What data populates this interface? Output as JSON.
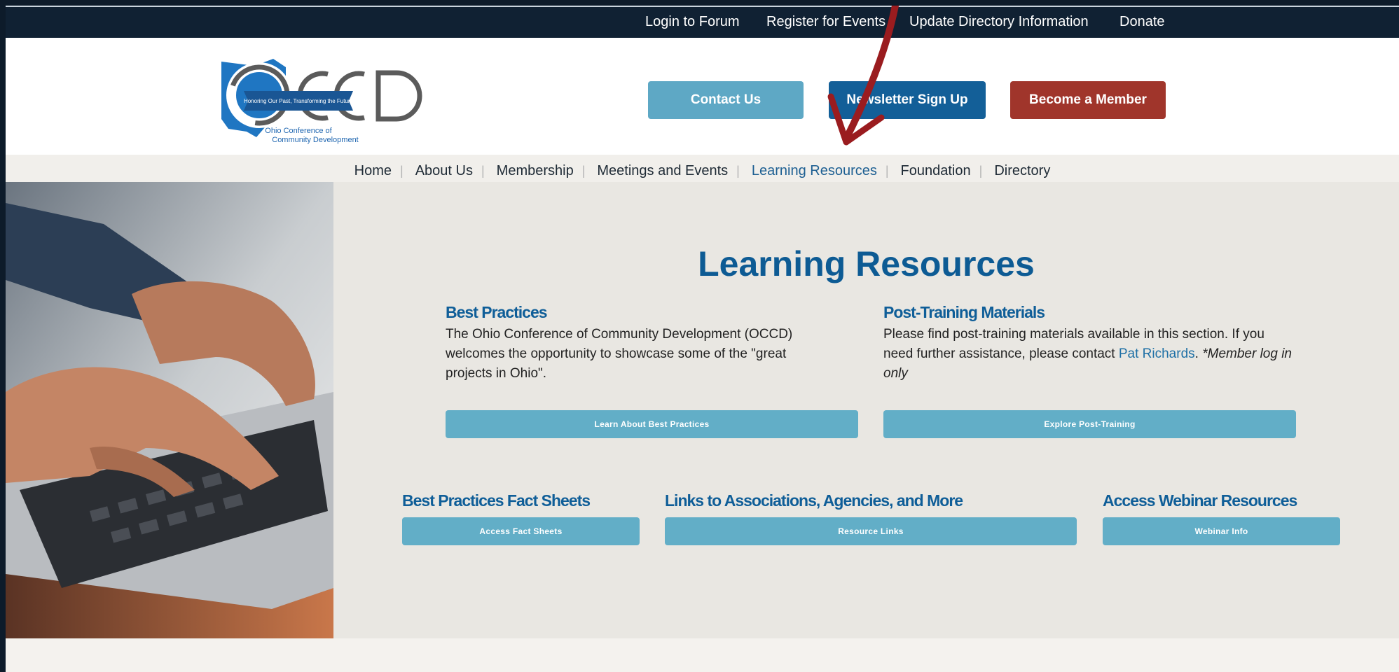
{
  "topbar": {
    "links": [
      "Login to Forum",
      "Register for Events",
      "Update Directory Information",
      "Donate"
    ]
  },
  "header": {
    "logo": {
      "text": "OCCD",
      "banner": "Honoring Our Past, Transforming the Future",
      "tagline_line1": "Ohio Conference of",
      "tagline_line2": "Community Development"
    },
    "buttons": {
      "contact": "Contact Us",
      "newsletter": "Newsletter Sign Up",
      "member": "Become a Member"
    }
  },
  "nav": {
    "items": [
      "Home",
      "About Us",
      "Membership",
      "Meetings and Events",
      "Learning Resources",
      "Foundation",
      "Directory"
    ],
    "active": "Learning Resources"
  },
  "main": {
    "title": "Learning Resources",
    "best_practices": {
      "heading": "Best Practices",
      "text": "The Ohio Conference of Community Development (OCCD) welcomes the opportunity to showcase some of the \"great projects in Ohio\".",
      "button": "Learn About Best Practices"
    },
    "post_training": {
      "heading": "Post-Training Materials",
      "text_before": "Please find post-training materials available in this section. If you need further assistance, please contact ",
      "link": "Pat Richards",
      "text_after": ". ",
      "note": "*Member log in only",
      "button": "Explore Post-Training"
    },
    "fact_sheets": {
      "heading": "Best Practices Fact Sheets",
      "button": "Access Fact Sheets"
    },
    "links": {
      "heading": "Links to Associations, Agencies, and More",
      "button": "Resource Links"
    },
    "webinar": {
      "heading": "Access Webinar Resources",
      "button": "Webinar Info"
    }
  },
  "colors": {
    "navy": "#102133",
    "accent_blue": "#0d5b94",
    "button_teal": "#62aec7",
    "contact_button": "#5ea8c5",
    "newsletter_button": "#135f98",
    "member_button": "#a0352b",
    "annotation_arrow": "#9a1c1f"
  }
}
